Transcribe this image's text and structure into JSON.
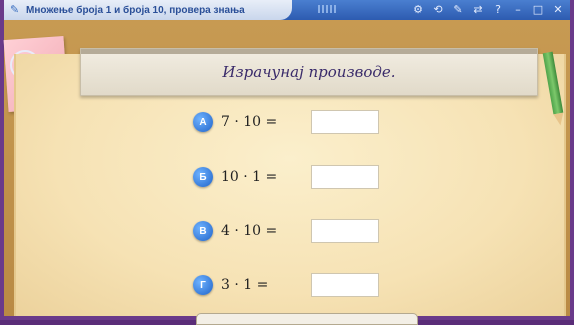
{
  "window": {
    "title": "Множење броја 1 и броја 10, провера знања",
    "buttons": [
      "tools-icon",
      "refresh-icon",
      "pen-icon",
      "shuffle-icon",
      "help-icon",
      "minimize-icon",
      "maximize-icon",
      "close-icon"
    ],
    "button_glyphs": [
      "⚙",
      "⟲",
      "✎",
      "⇄",
      "?",
      "–",
      "□",
      "✕"
    ]
  },
  "header": {
    "instruction": "Израчунај производе."
  },
  "tasks": [
    {
      "letter": "А",
      "expression": "7 · 10 =",
      "answer": ""
    },
    {
      "letter": "Б",
      "expression": "10 · 1 =",
      "answer": ""
    },
    {
      "letter": "В",
      "expression": "4 · 10 =",
      "answer": ""
    },
    {
      "letter": "Г",
      "expression": "3 · 1 =",
      "answer": ""
    }
  ],
  "colors": {
    "frame": "#6a3a8a",
    "titlebar": "#2d5bb0",
    "badge": "#1f63c9",
    "paper": "#f6e2b4"
  }
}
